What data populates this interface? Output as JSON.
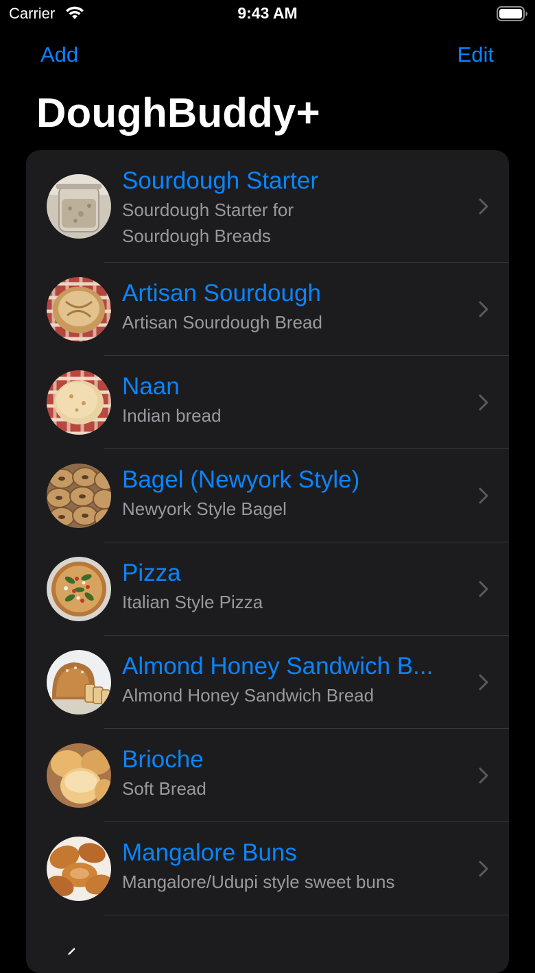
{
  "status_bar": {
    "carrier": "Carrier",
    "time": "9:43 AM"
  },
  "nav": {
    "left_label": "Add",
    "right_label": "Edit"
  },
  "title": "DoughBuddy+",
  "recipes": [
    {
      "title": "Sourdough Starter",
      "subtitle": "Sourdough Starter for Sourdough Breads",
      "thumbnail": "sourdough-starter-jar"
    },
    {
      "title": "Artisan Sourdough",
      "subtitle": "Artisan Sourdough Bread",
      "thumbnail": "artisan-loaf"
    },
    {
      "title": "Naan",
      "subtitle": "Indian bread",
      "thumbnail": "naan-flatbread"
    },
    {
      "title": "Bagel (Newyork Style)",
      "subtitle": "Newyork Style Bagel",
      "thumbnail": "bagels"
    },
    {
      "title": "Pizza",
      "subtitle": "Italian Style Pizza",
      "thumbnail": "pizza"
    },
    {
      "title": "Almond Honey Sandwich B...",
      "subtitle": "Almond Honey Sandwich Bread",
      "thumbnail": "sandwich-loaf"
    },
    {
      "title": "Brioche",
      "subtitle": "Soft Bread",
      "thumbnail": "brioche-buns"
    },
    {
      "title": "Mangalore Buns",
      "subtitle": "Mangalore/Udupi style sweet buns",
      "thumbnail": "mangalore-buns"
    }
  ],
  "colors": {
    "accent": "#0a84ff",
    "background": "#000000",
    "card": "#1c1c1e",
    "separator": "#38383a",
    "secondary_text": "#98989f",
    "chevron": "#5a5a5f"
  }
}
